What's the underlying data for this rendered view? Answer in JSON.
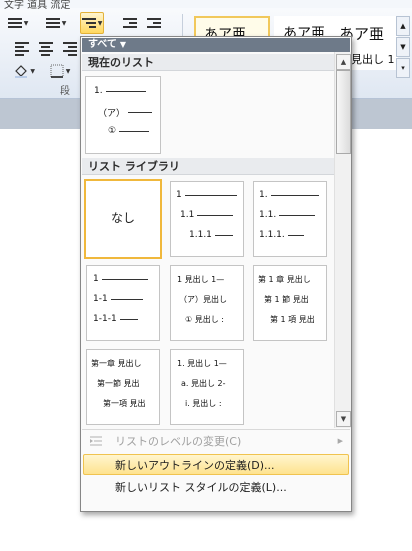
{
  "ribbon": {
    "top_text": "文字  道具 流定",
    "styles": [
      {
        "sample": "あア亜",
        "caption": ""
      },
      {
        "sample": "あア亜",
        "caption": ""
      },
      {
        "sample": "あア亜",
        "caption": "見出し 1"
      }
    ],
    "group_label": "段"
  },
  "panel": {
    "filter_label": "すべて",
    "current_section": "現在のリスト",
    "current_list": [
      "1.",
      "（ア）",
      "①"
    ],
    "library_section": "リスト ライブラリ",
    "none_label": "なし",
    "library": [
      {
        "rows": [
          "1",
          "1.1",
          "1.1.1"
        ]
      },
      {
        "rows": [
          "1.",
          "1.1.",
          "1.1.1."
        ]
      },
      {
        "rows": [
          "1",
          "1-1",
          "1-1-1"
        ]
      },
      {
        "rows": [
          "1 見出し 1—",
          "（ア）見出し",
          "① 見出し :"
        ]
      },
      {
        "rows": [
          "第 1 章 見出し",
          "第 1 節 見出",
          "第 1 項 見出"
        ]
      },
      {
        "rows": [
          "第一章 見出し",
          "第一節 見出",
          "第一項 見出"
        ]
      },
      {
        "rows": [
          "1. 見出し 1—",
          "a. 見出し 2-",
          "i. 見出し :"
        ]
      }
    ],
    "menu": {
      "change_level": "リストのレベルの変更(C)",
      "define_outline": "新しいアウトラインの定義(D)...",
      "define_style": "新しいリスト スタイルの定義(L)..."
    }
  }
}
